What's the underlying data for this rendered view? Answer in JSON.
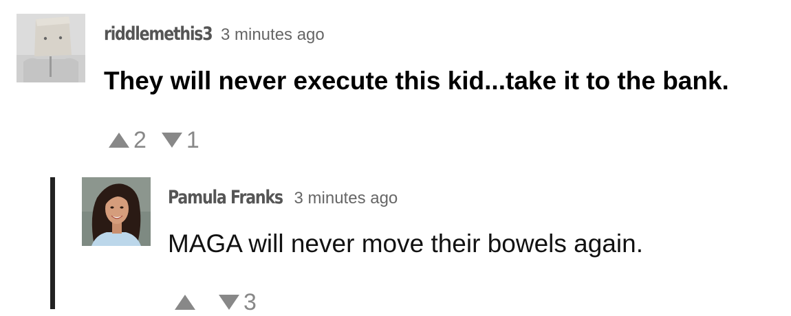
{
  "comments": [
    {
      "author": "riddlemethis3",
      "time": "3 minutes ago",
      "text": "They will never execute this kid...take it to the bank.",
      "upvotes": "2",
      "downvotes": "1",
      "avatar_icon": "paper-bag-head-avatar"
    },
    {
      "author": "Pamula Franks",
      "time": "3 minutes ago",
      "text": "MAGA will never move their bowels again.",
      "upvotes": "",
      "downvotes": "3",
      "avatar_icon": "woman-portrait-avatar"
    }
  ],
  "colors": {
    "meta_gray": "#666666",
    "vote_gray": "#888888",
    "reply_bar": "#222222"
  }
}
